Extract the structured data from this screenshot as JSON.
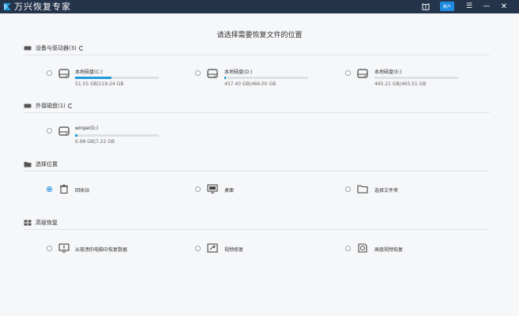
{
  "window": {
    "title": "万兴恢复专家",
    "account_label": "帐户"
  },
  "page_title": "请选择需要恢复文件的位置",
  "sections": {
    "devices": {
      "label": "设备与驱动器(3)"
    },
    "external": {
      "label": "外接磁盘(1)"
    },
    "location": {
      "label": "选择位置"
    },
    "advanced": {
      "label": "高级恢复"
    }
  },
  "drives": [
    {
      "name": "本地磁盘(C:)",
      "size": "51.55 GB|119.24 GB",
      "usage": 0.43
    },
    {
      "name": "本地磁盘(D:)",
      "size": "457.40 GB|466.00 GB",
      "usage": 0.02
    },
    {
      "name": "本地磁盘(E:)",
      "size": "465.21 GB|465.51 GB",
      "usage": 0.0
    }
  ],
  "external_drives": [
    {
      "name": "winpe(G:)",
      "size": "6.98 GB|7.22 GB",
      "usage": 0.03
    }
  ],
  "locations": [
    {
      "label": "回收站",
      "selected": true
    },
    {
      "label": "桌面",
      "selected": false
    },
    {
      "label": "选择文件夹",
      "selected": false
    }
  ],
  "advanced_items": [
    {
      "label": "从崩溃的电脑中恢复数据"
    },
    {
      "label": "视频修复"
    },
    {
      "label": "高级视频恢复"
    }
  ],
  "colors": {
    "titlebar": "#24344a",
    "accent": "#1f8be0",
    "bar_fill": "#1f9bd8"
  }
}
